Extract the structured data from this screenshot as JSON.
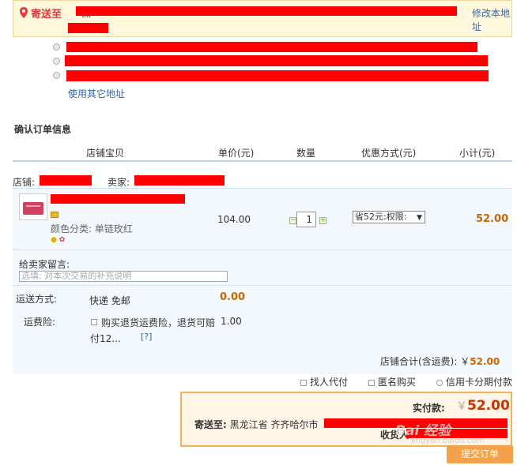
{
  "address": {
    "label": "寄送至",
    "prefix": "黑",
    "modify_link": "修改本地址",
    "other_address_link": "使用其它地址"
  },
  "order": {
    "section_title": "确认订单信息",
    "columns": [
      "店铺宝贝",
      "单价(元)",
      "数量",
      "优惠方式(元)",
      "小计(元)"
    ],
    "shop_label": "店铺:",
    "seller_label": "卖家:",
    "item": {
      "variant": "颜色分类: 单链玫红",
      "price": "104.00",
      "quantity": "1",
      "discount": "省52元:权限:",
      "subtotal": "52.00"
    }
  },
  "extras": {
    "message_label": "给卖家留言:",
    "message_placeholder": "选填: 对本次交易的补充说明",
    "shipping_label": "运送方式:",
    "shipping_value": "快递 免邮",
    "shipping_fee": "0.00",
    "insurance_label": "运费险:",
    "insurance_text_line1": "购买退货运费险，退货可赔",
    "insurance_fee": "1.00",
    "insurance_text_line2": "付12...",
    "help_link": "[?]",
    "shop_total_label": "店铺合计(含运费):",
    "shop_total_currency": "￥",
    "shop_total_value": "52.00"
  },
  "options": {
    "proxy_pay": "找人代付",
    "anonymous": "匿名购买",
    "installment": "信用卡分期付款"
  },
  "payment": {
    "actual_label": "实付款:",
    "currency": "￥",
    "amount": "52.00",
    "ship_to_label": "寄送至:",
    "ship_to_value": "黑龙江省 齐齐哈尔市",
    "receiver_label": "收货人:",
    "submit_label": "提交订单"
  },
  "watermark": {
    "brand": "Bai 经验",
    "url": "jingyan.baidu.com"
  }
}
